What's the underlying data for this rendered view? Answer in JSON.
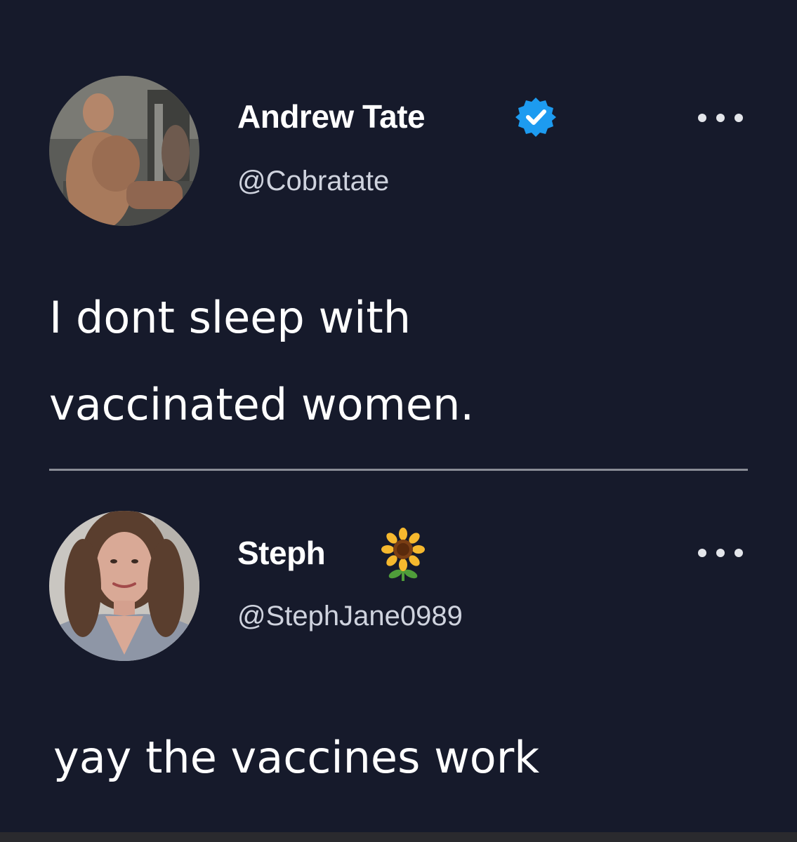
{
  "tweet": {
    "display_name": "Andrew Tate",
    "handle": "@Cobratate",
    "verified_icon": "verified-badge-icon",
    "text_lines": [
      "I dont sleep with",
      "vaccinated women."
    ],
    "more_icon": "more-options-icon"
  },
  "reply": {
    "display_name": "Steph",
    "handle": "@StephJane0989",
    "name_emoji_icon": "sunflower-icon",
    "text": "yay the vaccines work",
    "more_icon": "more-options-icon"
  },
  "colors": {
    "background": "#161a2b",
    "verified_blue": "#1d9bf0",
    "divider": "#8a8d96",
    "handle_text": "#cfd3de"
  }
}
